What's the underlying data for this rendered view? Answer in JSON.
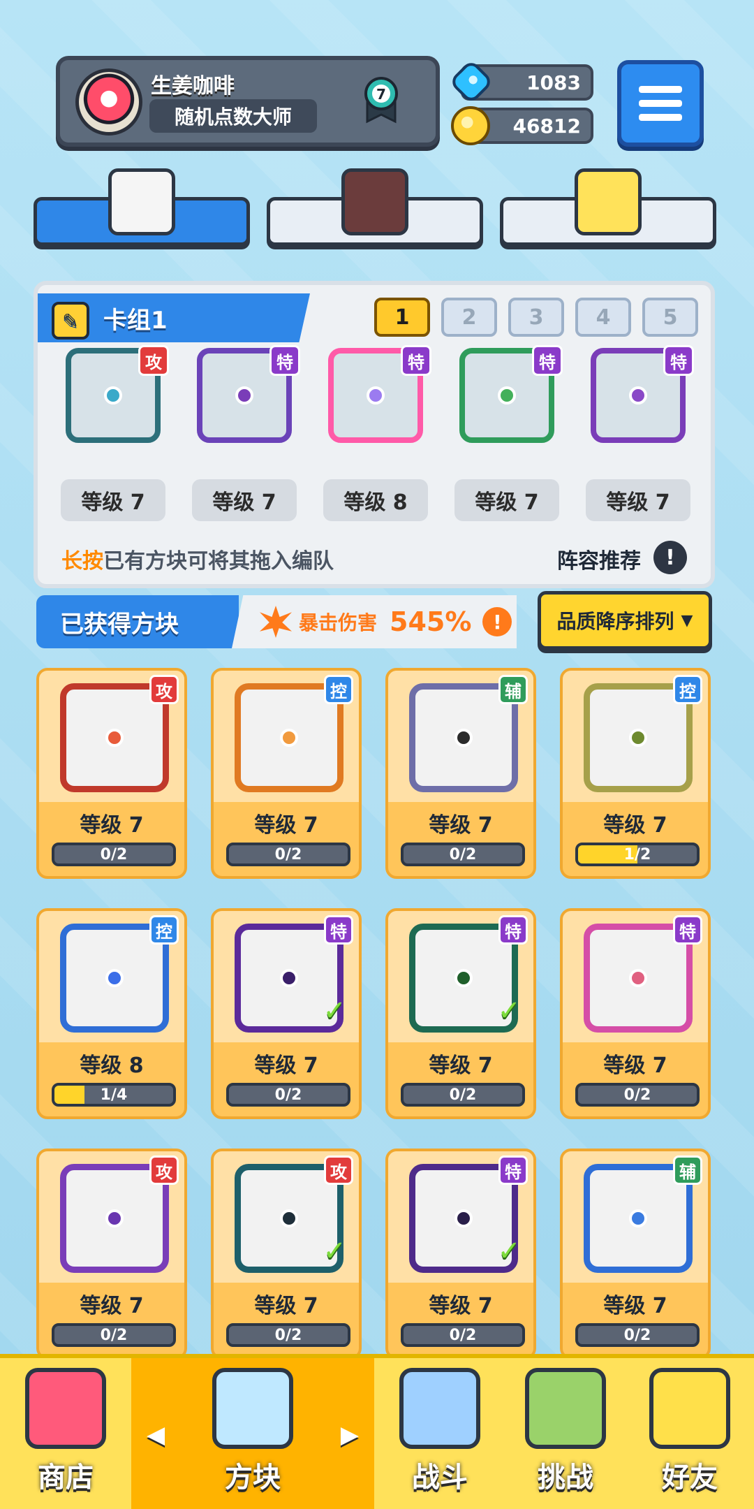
{
  "profile": {
    "nickname": "生姜咖啡",
    "title": "随机点数大师",
    "rank": "7"
  },
  "currency": {
    "gems": "1083",
    "coins": "46812"
  },
  "deck": {
    "title": "卡组1",
    "tabs": [
      "1",
      "2",
      "3",
      "4",
      "5"
    ],
    "active_tab": "1",
    "cards": [
      {
        "type": "攻",
        "level": "等级 7",
        "frame": "#2c6f7a",
        "dot": "#3aa9c9",
        "type_color": "#e23b3b"
      },
      {
        "type": "特",
        "level": "等级 7",
        "frame": "#6a43b8",
        "dot": "#7a3db8",
        "type_color": "#8a3ac9"
      },
      {
        "type": "特",
        "level": "等级 8",
        "frame": "#ff5aa8",
        "dot": "#9b7bf0",
        "type_color": "#8a3ac9"
      },
      {
        "type": "特",
        "level": "等级 7",
        "frame": "#2f9c5b",
        "dot": "#43b05a",
        "type_color": "#8a3ac9"
      },
      {
        "type": "特",
        "level": "等级 7",
        "frame": "#7a3db8",
        "dot": "#8a49c7",
        "type_color": "#8a3ac9"
      }
    ],
    "hint": {
      "emphasis": "长按",
      "rest": "已有方块可将其拖入编队"
    },
    "lineup_label": "阵容推荐",
    "lineup_icon": "!"
  },
  "obtained": {
    "label": "已获得方块",
    "crit_label": "暴击伤害",
    "crit_value": "545%",
    "crit_info": "!",
    "sort_label": "品质降序排列",
    "sort_caret": "▼"
  },
  "grid": [
    {
      "type": "攻",
      "type_color": "#e23b3b",
      "frame": "#c0392b",
      "dot": "#e85b3a",
      "level": "等级 7",
      "progress": "0/2",
      "fill": 0,
      "check": false
    },
    {
      "type": "控",
      "type_color": "#2f87e8",
      "frame": "#e07a22",
      "dot": "#f19a3e",
      "level": "等级 7",
      "progress": "0/2",
      "fill": 0,
      "check": false
    },
    {
      "type": "辅",
      "type_color": "#2f9c5b",
      "frame": "#6e6ea8",
      "dot": "#2b2b2b",
      "level": "等级 7",
      "progress": "0/2",
      "fill": 0,
      "check": false
    },
    {
      "type": "控",
      "type_color": "#2f87e8",
      "frame": "#a6a04a",
      "dot": "#6e8a2f",
      "level": "等级 7",
      "progress": "1/2",
      "fill": 0.5,
      "check": false
    },
    {
      "type": "控",
      "type_color": "#2f87e8",
      "frame": "#2f6ed6",
      "dot": "#3b6ee8",
      "level": "等级 8",
      "progress": "1/4",
      "fill": 0.25,
      "check": false
    },
    {
      "type": "特",
      "type_color": "#8a3ac9",
      "frame": "#5b2a9a",
      "dot": "#3a1f6a",
      "level": "等级 7",
      "progress": "0/2",
      "fill": 0,
      "check": true
    },
    {
      "type": "特",
      "type_color": "#8a3ac9",
      "frame": "#1d6a52",
      "dot": "#1f5f2b",
      "level": "等级 7",
      "progress": "0/2",
      "fill": 0,
      "check": true
    },
    {
      "type": "特",
      "type_color": "#8a3ac9",
      "frame": "#d54ea7",
      "dot": "#e06080",
      "level": "等级 7",
      "progress": "0/2",
      "fill": 0,
      "check": false
    },
    {
      "type": "攻",
      "type_color": "#e23b3b",
      "frame": "#7a3db8",
      "dot": "#6a36b0",
      "level": "等级 7",
      "progress": "0/2",
      "fill": 0,
      "check": false
    },
    {
      "type": "攻",
      "type_color": "#e23b3b",
      "frame": "#1d5f6a",
      "dot": "#1f2f3a",
      "level": "等级 7",
      "progress": "0/2",
      "fill": 0,
      "check": true
    },
    {
      "type": "特",
      "type_color": "#8a3ac9",
      "frame": "#4e2a8a",
      "dot": "#2a1f4a",
      "level": "等级 7",
      "progress": "0/2",
      "fill": 0,
      "check": true
    },
    {
      "type": "辅",
      "type_color": "#2f9c5b",
      "frame": "#2f6ed6",
      "dot": "#3a7be0",
      "level": "等级 7",
      "progress": "0/2",
      "fill": 0,
      "check": false
    }
  ],
  "nav": [
    {
      "label": "商店",
      "icon": "shop-icon",
      "color": "#ff5a7b"
    },
    {
      "label": "方块",
      "icon": "cube-icon",
      "color": "#bfe8ff"
    },
    {
      "label": "战斗",
      "icon": "battle-icon",
      "color": "#9fd0ff"
    },
    {
      "label": "挑战",
      "icon": "challenge-icon",
      "color": "#9ad26a"
    },
    {
      "label": "好友",
      "icon": "friends-icon",
      "color": "#ffe04a"
    }
  ],
  "arrows": {
    "left": "◀",
    "right": "▶"
  }
}
